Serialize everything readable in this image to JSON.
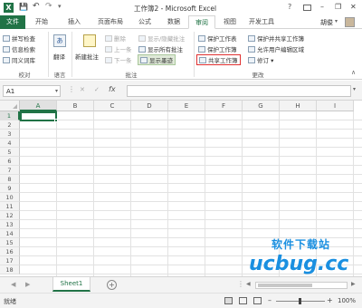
{
  "window": {
    "title": "工作簿2 - Microsoft Excel",
    "help": "?",
    "minimize": "–",
    "restore": "❐",
    "close": "✕"
  },
  "quick_access": {
    "save": "💾",
    "undo": "↶",
    "redo": "↷",
    "customize": "▾"
  },
  "tabs": [
    "文件",
    "开始",
    "插入",
    "页面布局",
    "公式",
    "数据",
    "审阅",
    "视图",
    "开发工具"
  ],
  "active_tab": "审阅",
  "account": {
    "user": "胡俊",
    "chevron": "▾"
  },
  "ribbon": {
    "proofing": {
      "label": "校对",
      "items": [
        "拼写检查",
        "信息检索",
        "同义词库"
      ]
    },
    "language": {
      "label": "语言",
      "translate": "翻译"
    },
    "comments": {
      "label": "批注",
      "new_comment": "新建批注",
      "delete": "删除",
      "previous": "上一条",
      "next": "下一条",
      "show_hide": "显示/隐藏批注",
      "show_all": "显示所有批注",
      "show_ink": "显示墨迹"
    },
    "changes": {
      "label": "更改",
      "protect_sheet": "保护工作表",
      "protect_workbook": "保护工作簿",
      "share_workbook": "共享工作簿",
      "protect_shared": "保护并共享工作簿",
      "allow_edit": "允许用户编辑区域",
      "track_changes": "修订",
      "track_arrow": "▾"
    },
    "collapse": "∧"
  },
  "formula_bar": {
    "name_box": "A1",
    "cancel": "✕",
    "enter": "✓",
    "fx": "fx",
    "value": ""
  },
  "grid": {
    "columns": [
      "A",
      "B",
      "C",
      "D",
      "E",
      "F",
      "G",
      "H",
      "I"
    ],
    "rows": [
      "1",
      "2",
      "3",
      "4",
      "5",
      "6",
      "7",
      "8",
      "9",
      "10",
      "11",
      "12",
      "13",
      "14",
      "15",
      "16",
      "17",
      "18"
    ],
    "selected_cell": "A1"
  },
  "sheets": {
    "tabs": [
      "Sheet1"
    ],
    "active": "Sheet1",
    "add": "+"
  },
  "status": {
    "text": "就绪",
    "zoom_minus": "–",
    "zoom_plus": "+",
    "zoom": "100%"
  },
  "watermark": {
    "site": "软件下载站",
    "logo": "ucbug.cc"
  },
  "colors": {
    "excel_green": "#217346",
    "highlight_red": "#e03030",
    "watermark_blue": "#1a8fe0",
    "watermark_orange": "#f08a1c"
  }
}
